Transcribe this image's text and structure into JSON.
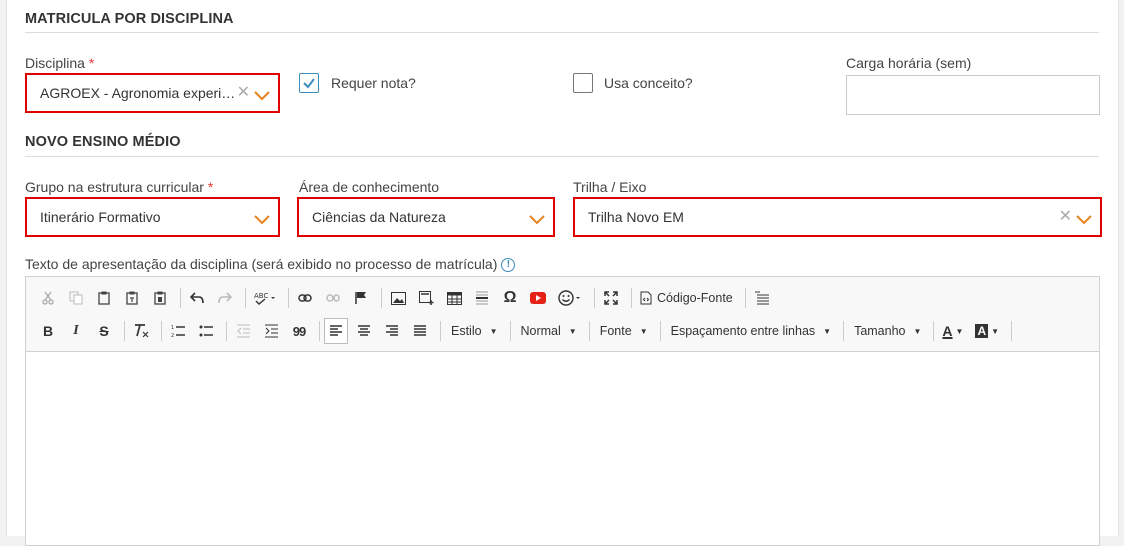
{
  "sections": {
    "matricula_title": "MATRICULA POR DISCIPLINA",
    "novo_ensino_title": "NOVO ENSINO MÉDIO"
  },
  "disciplina": {
    "label": "Disciplina",
    "required_mark": "*",
    "value": "AGROEX - Agronomia experim...",
    "clear_glyph": "✕"
  },
  "requer_nota": {
    "label": "Requer nota?",
    "checked": true
  },
  "usa_conceito": {
    "label": "Usa conceito?",
    "checked": false
  },
  "carga_horaria": {
    "label": "Carga horária (sem)",
    "value": ""
  },
  "grupo": {
    "label": "Grupo na estrutura curricular",
    "required_mark": "*",
    "value": "Itinerário Formativo"
  },
  "area": {
    "label": "Área de conhecimento",
    "value": "Ciências da Natureza"
  },
  "trilha": {
    "label": "Trilha / Eixo",
    "value": "Trilha Novo EM",
    "clear_glyph": "✕"
  },
  "texto_apresentacao": {
    "label": "Texto de apresentação da disciplina (será exibido no processo de matrícula)",
    "info_glyph": "!"
  },
  "toolbar": {
    "codigo_fonte": "Código-Fonte",
    "estilo": "Estilo",
    "normal": "Normal",
    "fonte": "Fonte",
    "espacamento": "Espaçamento entre linhas",
    "tamanho": "Tamanho",
    "omega": "Ω",
    "bold": "B",
    "italic": "I",
    "strike": "S",
    "quote": "99",
    "font_color": "A",
    "bg_color": "A"
  },
  "colors": {
    "highlight_border": "#e00000",
    "accent_orange": "#e8821e",
    "check_blue": "#3c8dbc",
    "youtube_red": "#e62117"
  }
}
